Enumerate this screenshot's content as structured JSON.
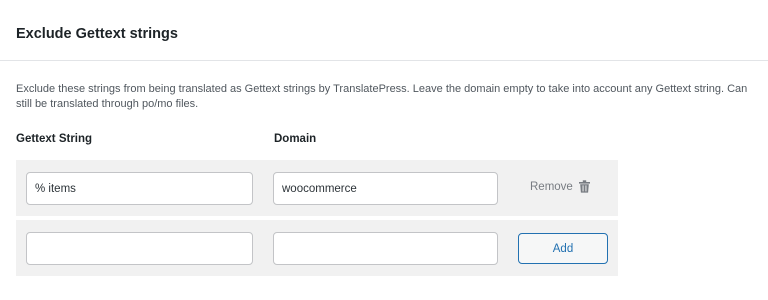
{
  "section": {
    "title": "Exclude Gettext strings",
    "description": "Exclude these strings from being translated as Gettext strings by TranslatePress. Leave the domain empty to take into account any Gettext string. Can still be translated through po/mo files."
  },
  "columns": {
    "string_header": "Gettext String",
    "domain_header": "Domain"
  },
  "rows": [
    {
      "string_value": "% items",
      "domain_value": "woocommerce",
      "remove_label": "Remove",
      "remove_icon": "trash-icon"
    }
  ],
  "new_row": {
    "string_value": "",
    "domain_value": "",
    "add_label": "Add"
  },
  "colors": {
    "accent": "#2271b1",
    "row_background": "#f1f1f1"
  }
}
